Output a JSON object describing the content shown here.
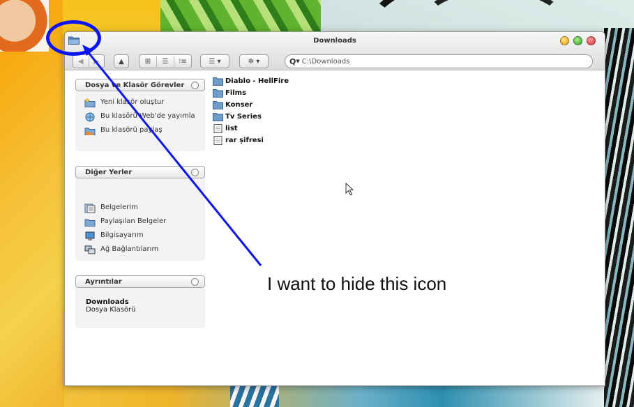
{
  "window": {
    "title": "Downloads",
    "controls": [
      "minimize",
      "maximize",
      "close"
    ]
  },
  "toolbar": {
    "back_icon": "back-arrow-icon",
    "forward_icon": "forward-arrow-icon",
    "up_icon": "up-arrow-icon",
    "view_icons": [
      "icon-view-icon",
      "list-view-icon",
      "detail-view-icon"
    ],
    "arrange_icon": "arrange-icon",
    "action_icon": "gear-icon",
    "search_glyph": "Q",
    "address_value": "C:\\Downloads"
  },
  "sidebar": {
    "tasks": {
      "header": "Dosya ve Klasör Görevler",
      "items": [
        {
          "label": "Yeni klasör oluştur",
          "icon": "new-folder-icon"
        },
        {
          "label": "Bu klasörü Web'de yayımla",
          "icon": "web-publish-icon"
        },
        {
          "label": "Bu klasörü paylaş",
          "icon": "share-folder-icon"
        }
      ]
    },
    "places": {
      "header": "Diğer Yerler",
      "items": [
        {
          "label": "Belgelerim",
          "icon": "documents-icon"
        },
        {
          "label": "Paylaşılan Belgeler",
          "icon": "shared-folder-icon"
        },
        {
          "label": "Bilgisayarım",
          "icon": "computer-icon"
        },
        {
          "label": "Ağ Bağlantılarım",
          "icon": "network-icon"
        }
      ]
    },
    "details": {
      "header": "Ayrıntılar",
      "name": "Downloads",
      "type": "Dosya Klasörü"
    }
  },
  "files": [
    {
      "name": "Diablo - HellFire",
      "kind": "folder"
    },
    {
      "name": "Films",
      "kind": "folder"
    },
    {
      "name": "Konser",
      "kind": "folder"
    },
    {
      "name": "Tv Series",
      "kind": "folder"
    },
    {
      "name": "list",
      "kind": "file"
    },
    {
      "name": "rar şifresi",
      "kind": "file"
    }
  ],
  "annotation": {
    "text": "I want to hide this icon",
    "color": "#0b14f2"
  },
  "colors": {
    "annotation_blue": "#0b14f2",
    "folder_blue": "#6f9cc9"
  }
}
